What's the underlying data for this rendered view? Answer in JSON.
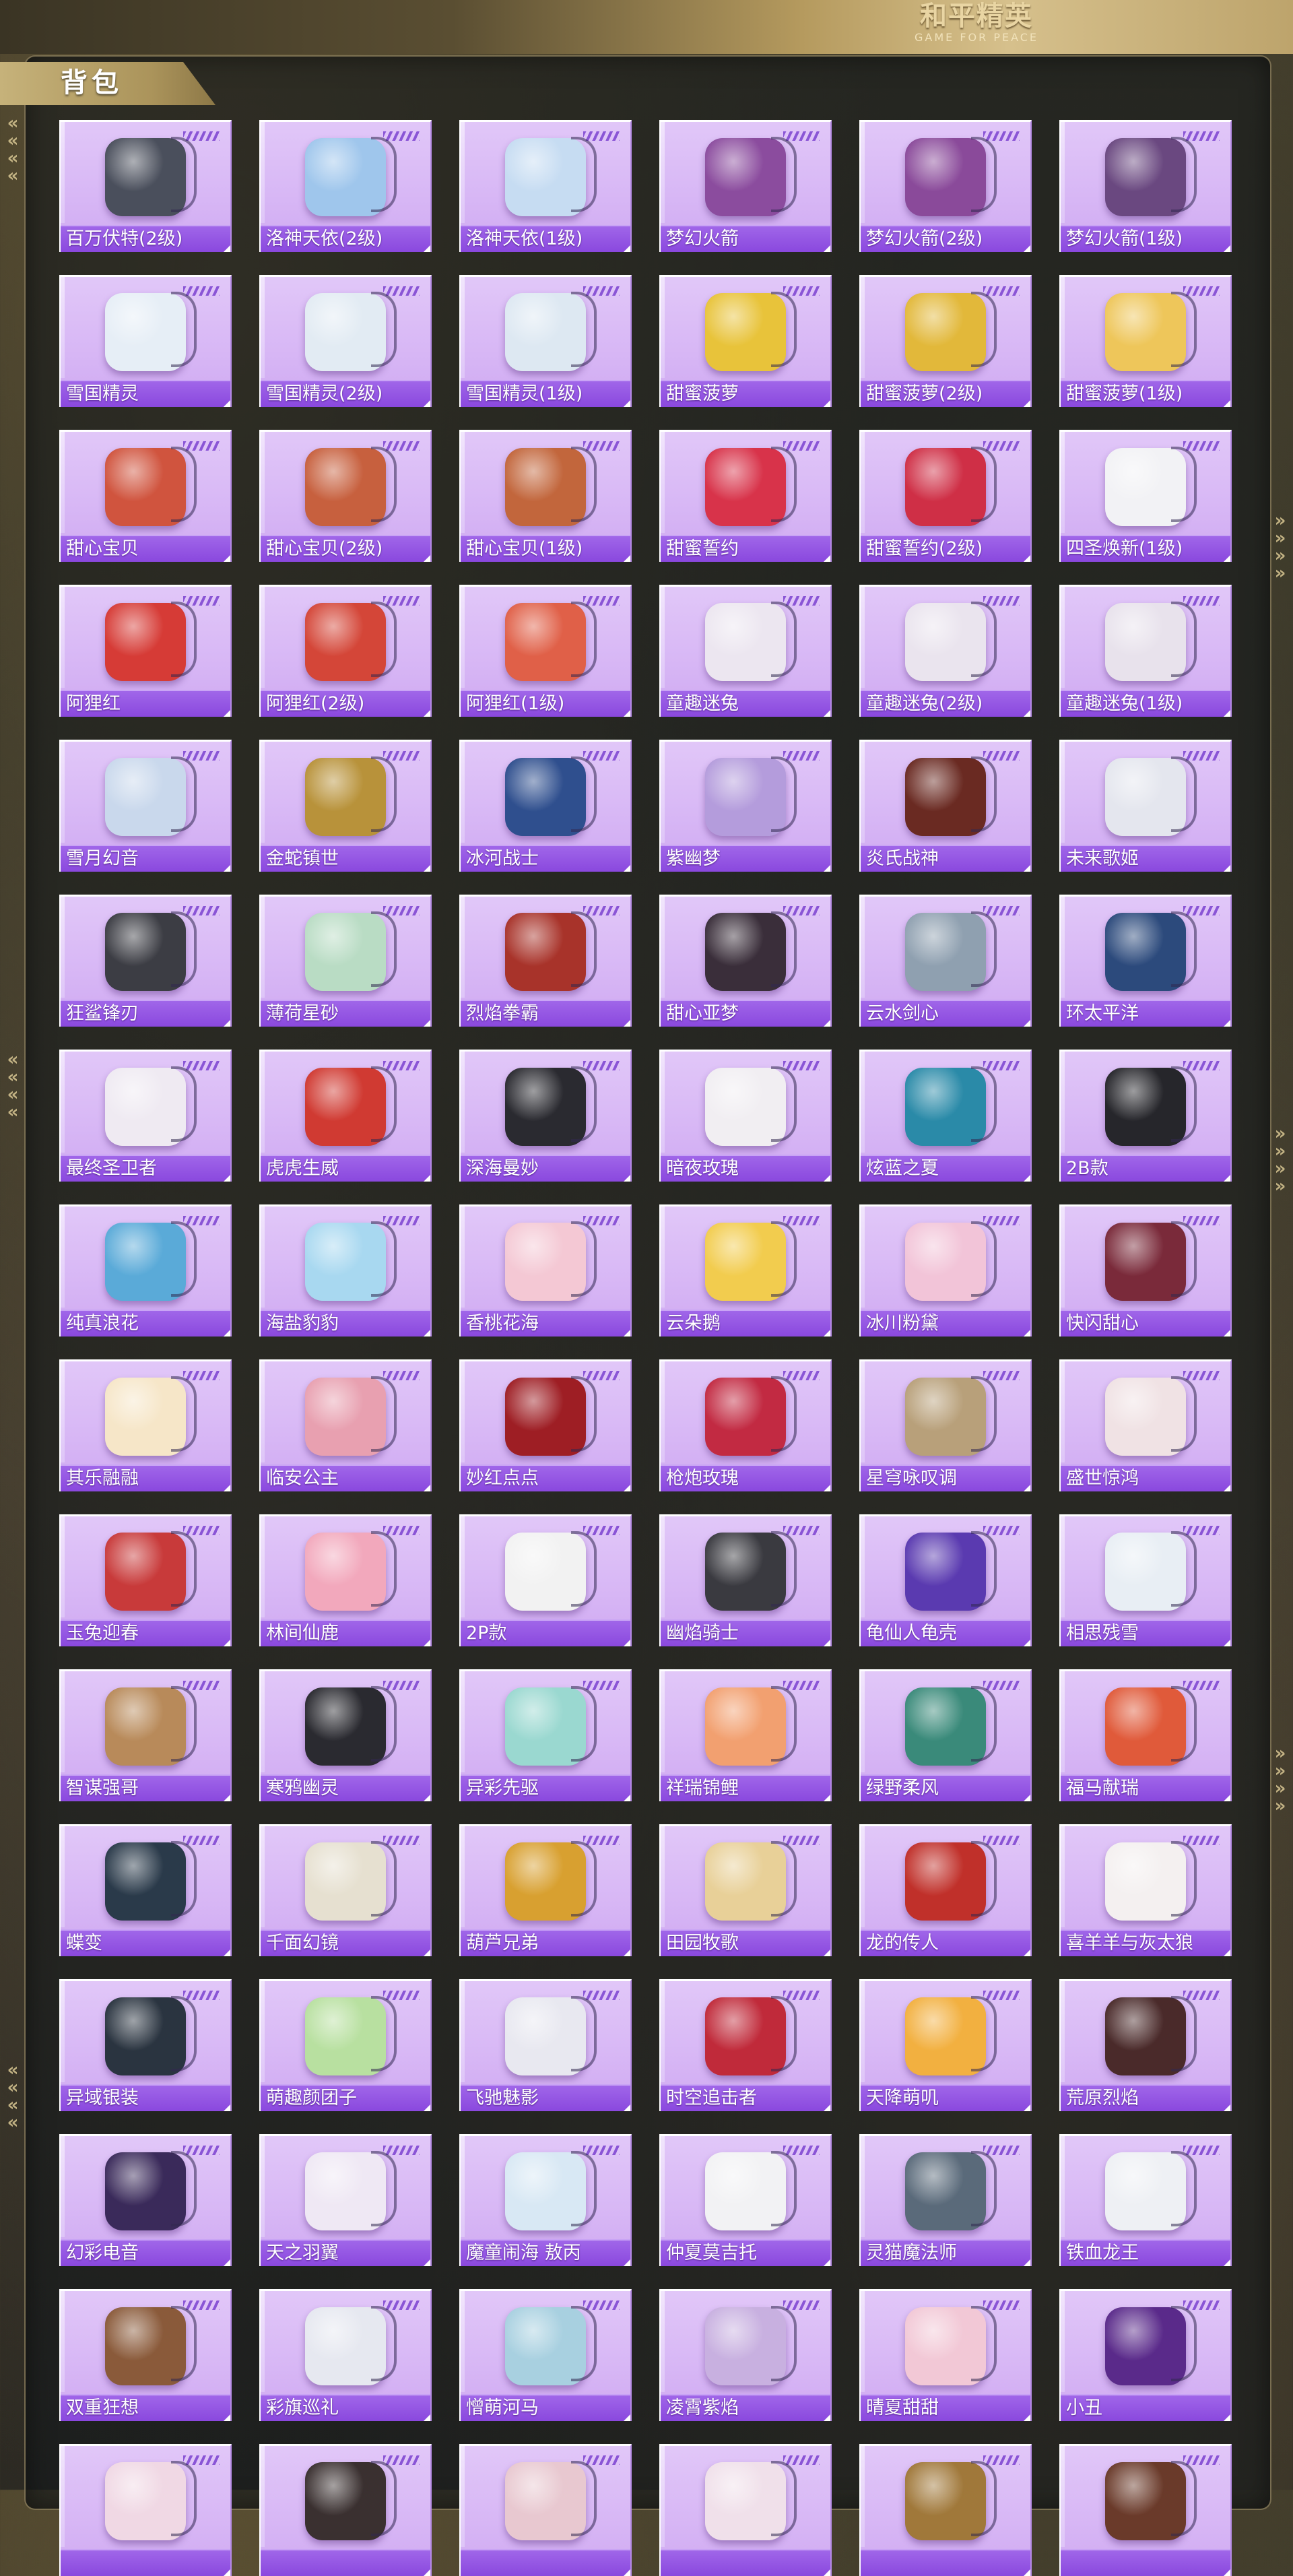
{
  "header": {
    "logo_main": "和平精英",
    "logo_sub": "GAME FOR PEACE"
  },
  "section": {
    "title": "背包"
  },
  "items": [
    {
      "name": "百万伏特(2级)",
      "color": "#4a4f5c"
    },
    {
      "name": "洛神天依(2级)",
      "color": "#9fc6ec"
    },
    {
      "name": "洛神天依(1级)",
      "color": "#c6dcf2"
    },
    {
      "name": "梦幻火箭",
      "color": "#8b4c9e"
    },
    {
      "name": "梦幻火箭(2级)",
      "color": "#8a4a9a"
    },
    {
      "name": "梦幻火箭(1级)",
      "color": "#6a4880"
    },
    {
      "name": "雪国精灵",
      "color": "#e6eef6"
    },
    {
      "name": "雪国精灵(2级)",
      "color": "#e2ebf3"
    },
    {
      "name": "雪国精灵(1级)",
      "color": "#dde8f2"
    },
    {
      "name": "甜蜜菠萝",
      "color": "#e8c33a"
    },
    {
      "name": "甜蜜菠萝(2级)",
      "color": "#e2b83a"
    },
    {
      "name": "甜蜜菠萝(1级)",
      "color": "#eec65a"
    },
    {
      "name": "甜心宝贝",
      "color": "#d0543e"
    },
    {
      "name": "甜心宝贝(2级)",
      "color": "#c7603e"
    },
    {
      "name": "甜心宝贝(1级)",
      "color": "#c2663c"
    },
    {
      "name": "甜蜜誓约",
      "color": "#d8334a"
    },
    {
      "name": "甜蜜誓约(2级)",
      "color": "#cf2f46"
    },
    {
      "name": "四圣焕新(1级)",
      "color": "#f2f2f5"
    },
    {
      "name": "阿狸红",
      "color": "#d63b36"
    },
    {
      "name": "阿狸红(2级)",
      "color": "#d44638"
    },
    {
      "name": "阿狸红(1级)",
      "color": "#e06048"
    },
    {
      "name": "童趣迷兔",
      "color": "#ece6f0"
    },
    {
      "name": "童趣迷兔(2级)",
      "color": "#eae4ee"
    },
    {
      "name": "童趣迷兔(1级)",
      "color": "#e8e2ec"
    },
    {
      "name": "雪月幻音",
      "color": "#c9d8ec"
    },
    {
      "name": "金蛇镇世",
      "color": "#b8923a"
    },
    {
      "name": "冰河战士",
      "color": "#2f4f8e"
    },
    {
      "name": "紫幽梦",
      "color": "#b49cdc"
    },
    {
      "name": "炎氏战神",
      "color": "#6a2a22"
    },
    {
      "name": "未来歌姬",
      "color": "#e4e6ee"
    },
    {
      "name": "狂鲨锋刃",
      "color": "#3c3d44"
    },
    {
      "name": "薄荷星砂",
      "color": "#b9dcc4"
    },
    {
      "name": "烈焰拳霸",
      "color": "#a8332a"
    },
    {
      "name": "甜心亚梦",
      "color": "#3a2e3a"
    },
    {
      "name": "云水剑心",
      "color": "#8fa0b0"
    },
    {
      "name": "环太平洋",
      "color": "#2c4a7c"
    },
    {
      "name": "最终圣卫者",
      "color": "#efeaf2"
    },
    {
      "name": "虎虎生威",
      "color": "#d03a32"
    },
    {
      "name": "深海曼妙",
      "color": "#2a2a30"
    },
    {
      "name": "暗夜玫瑰",
      "color": "#f1eef2"
    },
    {
      "name": "炫蓝之夏",
      "color": "#2a8aa8"
    },
    {
      "name": "2B款",
      "color": "#26262b"
    },
    {
      "name": "纯真浪花",
      "color": "#5aaad8"
    },
    {
      "name": "海盐豹豹",
      "color": "#a8d8f0"
    },
    {
      "name": "香桃花海",
      "color": "#f4c8d4"
    },
    {
      "name": "云朵鹅",
      "color": "#f2cc4e"
    },
    {
      "name": "冰川粉黛",
      "color": "#f2c4d8"
    },
    {
      "name": "快闪甜心",
      "color": "#7a2a3a"
    },
    {
      "name": "其乐融融",
      "color": "#f6e6c8"
    },
    {
      "name": "临安公主",
      "color": "#e8a0b0"
    },
    {
      "name": "妙红点点",
      "color": "#9e1e24"
    },
    {
      "name": "枪炮玫瑰",
      "color": "#c22a42"
    },
    {
      "name": "星穹咏叹调",
      "color": "#b8a07a"
    },
    {
      "name": "盛世惊鸿",
      "color": "#f0e2e4"
    },
    {
      "name": "玉兔迎春",
      "color": "#c83a3a"
    },
    {
      "name": "林间仙鹿",
      "color": "#f2a8bc"
    },
    {
      "name": "2P款",
      "color": "#f2f2f2"
    },
    {
      "name": "幽焰骑士",
      "color": "#3a3a40"
    },
    {
      "name": "龟仙人龟壳",
      "color": "#5a3ab0"
    },
    {
      "name": "相思残雪",
      "color": "#e8eef4"
    },
    {
      "name": "智谋强哥",
      "color": "#b88a5a"
    },
    {
      "name": "寒鸦幽灵",
      "color": "#2a2a30"
    },
    {
      "name": "异彩先驱",
      "color": "#9ad8d0"
    },
    {
      "name": "祥瑞锦鲤",
      "color": "#f2a070"
    },
    {
      "name": "绿野柔风",
      "color": "#3a8a7a"
    },
    {
      "name": "福马献瑞",
      "color": "#e05a3a"
    },
    {
      "name": "蝶变",
      "color": "#2a3a4a"
    },
    {
      "name": "千面幻镜",
      "color": "#e6e0d0"
    },
    {
      "name": "葫芦兄弟",
      "color": "#d8a030"
    },
    {
      "name": "田园牧歌",
      "color": "#e8d098"
    },
    {
      "name": "龙的传人",
      "color": "#c0302a"
    },
    {
      "name": "喜羊羊与灰太狼",
      "color": "#f4f0f0"
    },
    {
      "name": "异域银装",
      "color": "#2a3440"
    },
    {
      "name": "萌趣颜团子",
      "color": "#b8e0a0"
    },
    {
      "name": "飞驰魅影",
      "color": "#e8e8f0"
    },
    {
      "name": "时空追击者",
      "color": "#c02a3a"
    },
    {
      "name": "天降萌叽",
      "color": "#f2b040"
    },
    {
      "name": "荒原烈焰",
      "color": "#4a2a2a"
    },
    {
      "name": "幻彩电音",
      "color": "#3a2a5a"
    },
    {
      "name": "天之羽翼",
      "color": "#efe8f4"
    },
    {
      "name": "魔童闹海 敖丙",
      "color": "#d8e8f4"
    },
    {
      "name": "仲夏莫吉托",
      "color": "#f2f2f4"
    },
    {
      "name": "灵猫魔法师",
      "color": "#5a6a7a"
    },
    {
      "name": "铁血龙王",
      "color": "#eef0f4"
    },
    {
      "name": "双重狂想",
      "color": "#8a5a3a"
    },
    {
      "name": "彩旗巡礼",
      "color": "#e6e8f0"
    },
    {
      "name": "憎萌河马",
      "color": "#a8d0e0"
    },
    {
      "name": "凌霄紫焰",
      "color": "#c8b0e0"
    },
    {
      "name": "晴夏甜甜",
      "color": "#f2c8d6"
    },
    {
      "name": "小丑",
      "color": "#5a2a8a"
    },
    {
      "name": "",
      "color": "#f0d8e4"
    },
    {
      "name": "",
      "color": "#3a3030"
    },
    {
      "name": "",
      "color": "#e8c8d0"
    },
    {
      "name": "",
      "color": "#f0e0ea"
    },
    {
      "name": "",
      "color": "#a0783a"
    },
    {
      "name": "",
      "color": "#6a3a2a"
    }
  ]
}
